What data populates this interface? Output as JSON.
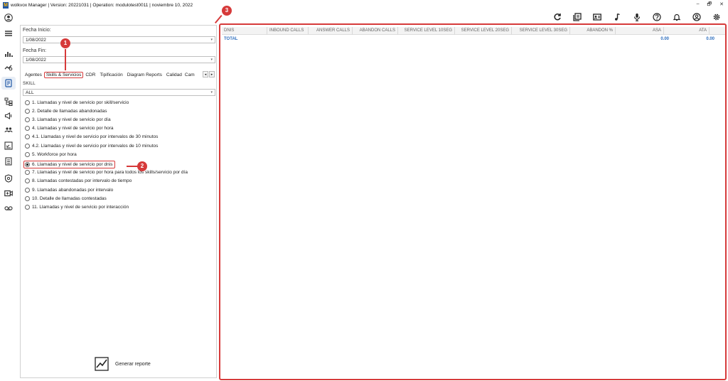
{
  "titlebar": {
    "title": "wolkvox Manager  | Version: 20221031  |  Operation: modulotest0011  |  noviembre 10, 2022",
    "minimize": "–",
    "restore": "🗗",
    "close": "✕"
  },
  "filters": {
    "start_label": "Fecha Inicio:",
    "start_value": "1/08/2022",
    "end_label": "Fecha Fin:",
    "end_value": "1/08/2022"
  },
  "tabs": [
    "Agentes",
    "Skills & Servicios",
    "CDR",
    "Tipificación",
    "Diagram Reports",
    "Calidad",
    "Cam"
  ],
  "skill": {
    "label": "SKILL",
    "value": "ALL"
  },
  "reports": [
    "1. Llamadas y nivel de servicio por skill/servicio",
    "2. Detalle de llamadas abandonadas",
    "3. Llamadas y nivel de servicio por día",
    "4. Llamadas y nivel de servicio por hora",
    "4.1. Llamadas y nivel de servicio por intervalos de 30 minutos",
    "4.2. Llamadas y nivel de servicio por intervalos de 10 minutos",
    "5. Workforce por hora",
    "6. Llamadas y nivel de servicio por dnis",
    "7. Llamadas y nivel de servicio por hora para todos los skills/servicio por día",
    "8. Llamadas contestadas por intervalo de tiempo",
    "9. Llamadas abandonadas por intervalo",
    "10. Detalle de llamadas contestadas",
    "11. Llamadas y nivel de servicio por interacción"
  ],
  "selected_report_index": 7,
  "generate_label": "Generar reporte",
  "grid": {
    "columns": [
      "DNIS",
      "INBOUND CALLS",
      "ANSWER CALLS",
      "ABANDON CALLS",
      "SERVICE LEVEL 10SEG",
      "SERVICE LEVEL 20SEG",
      "SERVICE LEVEL 30SEG",
      "ABANDON %",
      "ASA",
      "ATA"
    ],
    "total_label": "TOTAL",
    "asa_total": "0.00",
    "ata_total": "0.00"
  },
  "annotations": [
    "1",
    "2",
    "3"
  ],
  "colors": {
    "accent_red": "#d63a3a",
    "link_blue": "#2f6fbe"
  }
}
